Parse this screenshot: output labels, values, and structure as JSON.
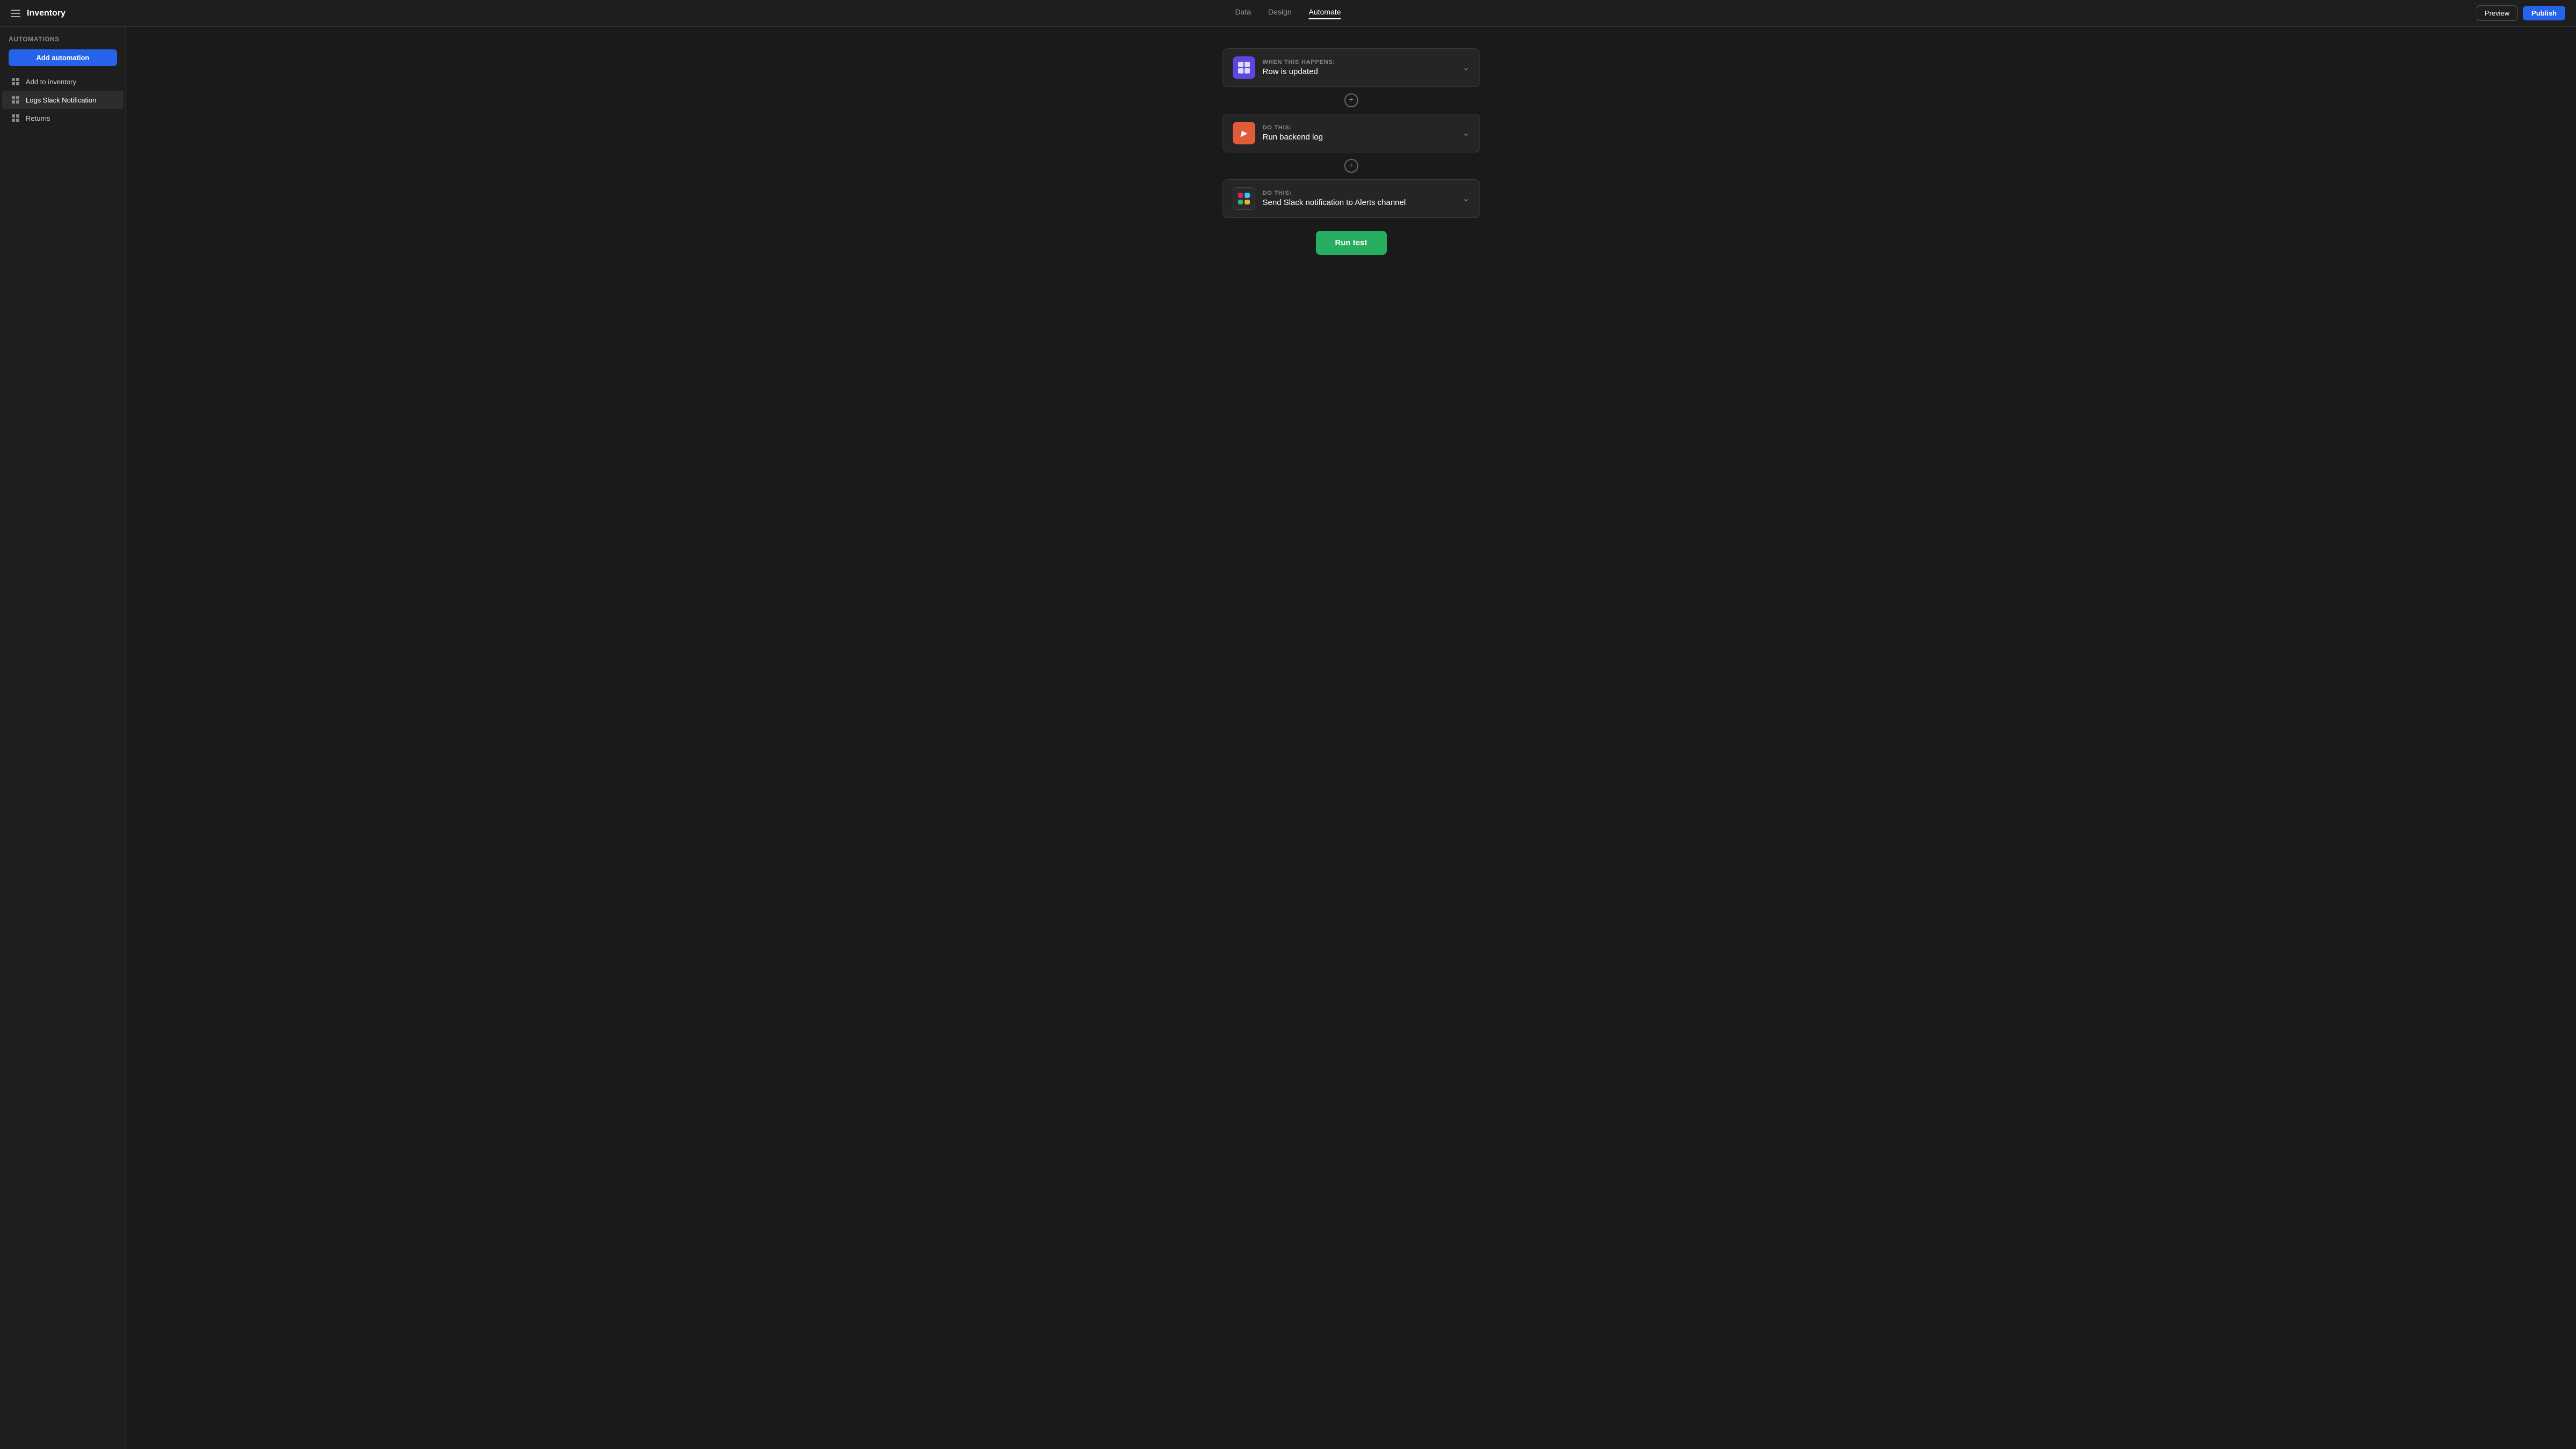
{
  "app": {
    "title": "Inventory",
    "nav": {
      "tabs": [
        {
          "id": "data",
          "label": "Data",
          "active": false
        },
        {
          "id": "design",
          "label": "Design",
          "active": false
        },
        {
          "id": "automate",
          "label": "Automate",
          "active": true
        }
      ]
    },
    "toolbar": {
      "preview_label": "Preview",
      "publish_label": "Publish"
    }
  },
  "sidebar": {
    "heading": "Automations",
    "add_button_label": "Add automation",
    "items": [
      {
        "id": "add-to-inventory",
        "label": "Add to inventory",
        "active": false
      },
      {
        "id": "logs-slack-notification",
        "label": "Logs Slack Notification",
        "active": true
      },
      {
        "id": "returns",
        "label": "Returns",
        "active": false
      }
    ]
  },
  "automation": {
    "trigger": {
      "label": "WHEN THIS HAPPENS:",
      "title": "Row is updated"
    },
    "step1": {
      "label": "DO THIS:",
      "title": "Run backend log"
    },
    "step2": {
      "label": "DO THIS:",
      "title": "Send Slack notification to Alerts channel"
    },
    "run_test_label": "Run test"
  }
}
